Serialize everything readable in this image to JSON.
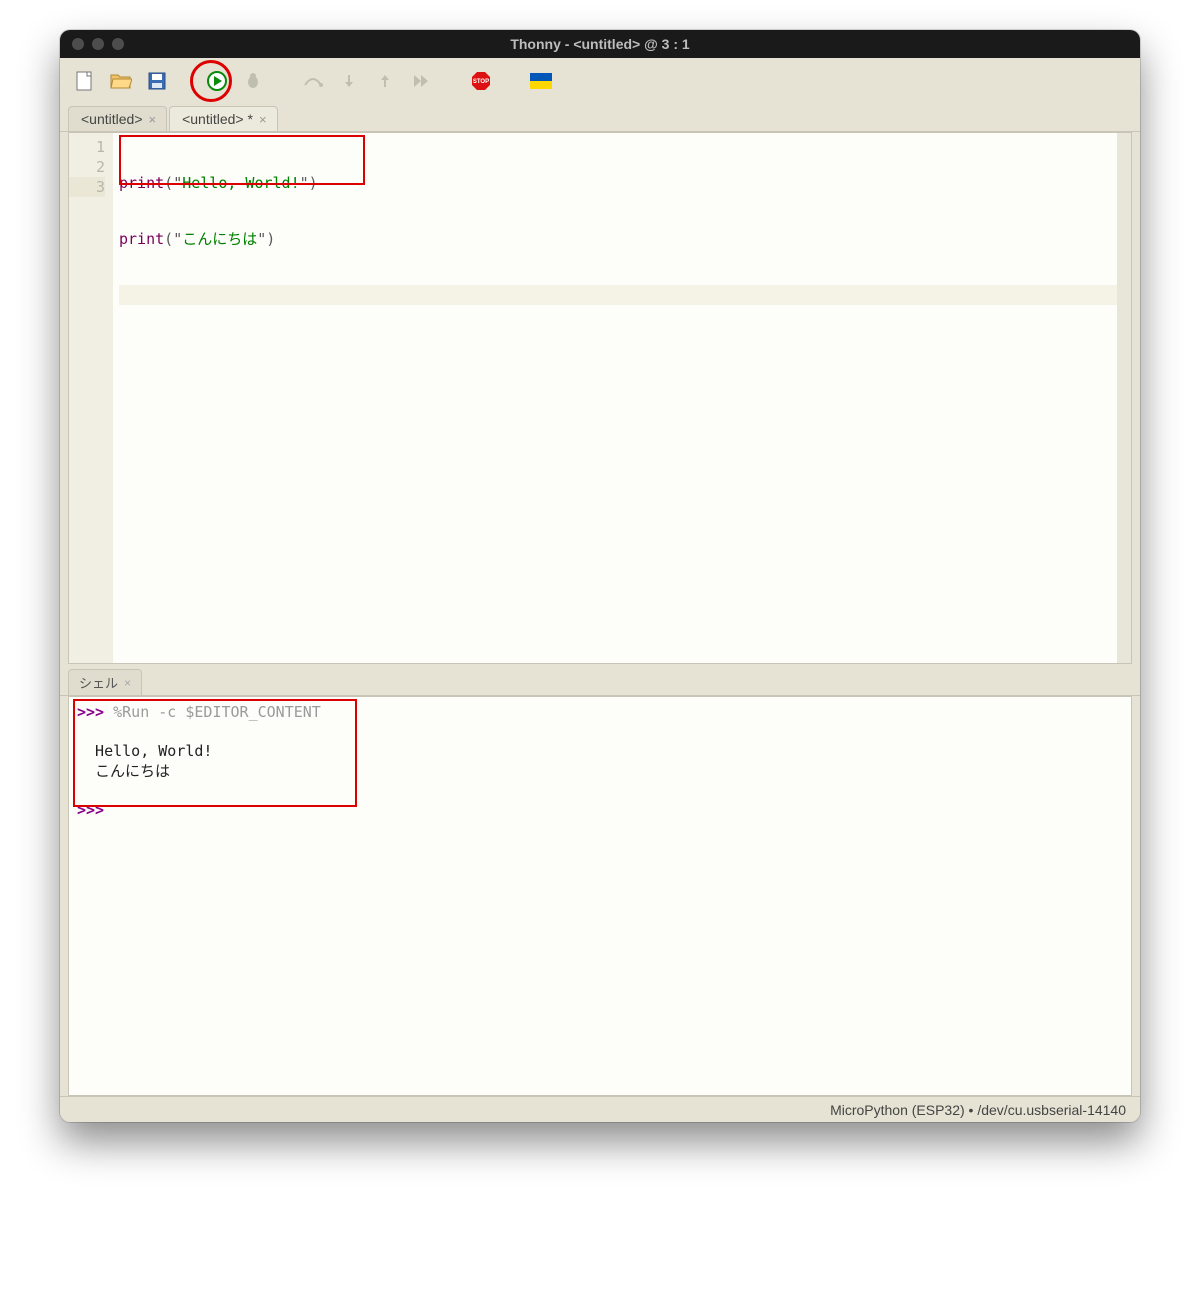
{
  "window": {
    "title": "Thonny  -  <untitled>  @  3 : 1"
  },
  "toolbar": {
    "icons": [
      "new-file",
      "open-file",
      "save-file",
      "run",
      "debug",
      "step-over",
      "step-into",
      "step-out",
      "resume",
      "stop",
      "flag"
    ]
  },
  "tabs": [
    {
      "label": "<untitled>",
      "active": false
    },
    {
      "label": "<untitled> *",
      "active": true
    }
  ],
  "editor": {
    "lines": [
      {
        "n": "1",
        "fn": "print",
        "open": "(",
        "q1": "\"",
        "str": "Hello, World!",
        "q2": "\"",
        "close": ")"
      },
      {
        "n": "2",
        "fn": "print",
        "open": "(",
        "q1": "\"",
        "str": "こんにちは",
        "q2": "\"",
        "close": ")"
      },
      {
        "n": "3",
        "current": true
      }
    ]
  },
  "shell": {
    "tab_label": "シェル",
    "prompt": ">>>",
    "run_cmd": " %Run -c $EDITOR_CONTENT",
    "output": "  Hello, World!\n  こんにちは",
    "prompt2": ">>> "
  },
  "status": {
    "text": "MicroPython (ESP32)  •  /dev/cu.usbserial-14140"
  }
}
